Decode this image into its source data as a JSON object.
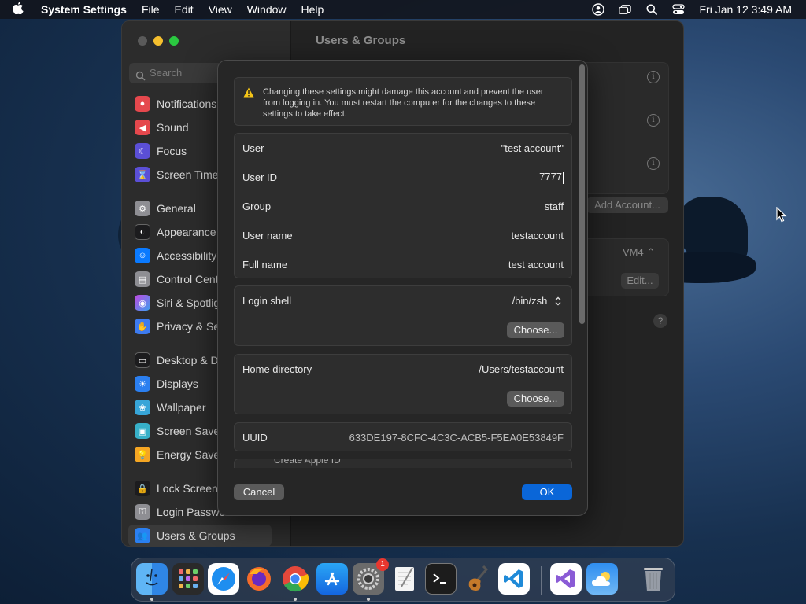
{
  "menubar": {
    "app_name": "System Settings",
    "menus": [
      "File",
      "Edit",
      "View",
      "Window",
      "Help"
    ],
    "clock": "Fri Jan 12  3:49 AM"
  },
  "sidebar": {
    "search_placeholder": "Search",
    "items": [
      {
        "label": "Notifications",
        "icon": "bell-icon",
        "color": "#e5484d"
      },
      {
        "label": "Sound",
        "icon": "speaker-icon",
        "color": "#e5484d"
      },
      {
        "label": "Focus",
        "icon": "moon-icon",
        "color": "#5b4fd6"
      },
      {
        "label": "Screen Time",
        "icon": "hourglass-icon",
        "color": "#5b4fd6"
      },
      {
        "label": "General",
        "icon": "gear-icon",
        "color": "#8e8e93"
      },
      {
        "label": "Appearance",
        "icon": "appearance-icon",
        "color": "#1c1c1e"
      },
      {
        "label": "Accessibility",
        "icon": "accessibility-icon",
        "color": "#0a7aff"
      },
      {
        "label": "Control Cente",
        "icon": "control-center-icon",
        "color": "#8e8e93"
      },
      {
        "label": "Siri & Spotlig",
        "icon": "siri-icon",
        "color": "#c148e0"
      },
      {
        "label": "Privacy & Sec",
        "icon": "hand-icon",
        "color": "#3d7bf0"
      },
      {
        "label": "Desktop & Do",
        "icon": "dock-icon",
        "color": "#1c1c1e"
      },
      {
        "label": "Displays",
        "icon": "sun-icon",
        "color": "#2b7ff0"
      },
      {
        "label": "Wallpaper",
        "icon": "wallpaper-icon",
        "color": "#37a5d8"
      },
      {
        "label": "Screen Saver",
        "icon": "screensaver-icon",
        "color": "#37b0c8"
      },
      {
        "label": "Energy Saver",
        "icon": "bulb-icon",
        "color": "#f5a623"
      },
      {
        "label": "Lock Screen",
        "icon": "lock-icon",
        "color": "#1c1c1e"
      },
      {
        "label": "Login Passwo",
        "icon": "key-icon",
        "color": "#8e8e93"
      },
      {
        "label": "Users & Groups",
        "icon": "users-icon",
        "color": "#2b7ff0"
      }
    ]
  },
  "content": {
    "title": "Users & Groups",
    "add_account": "Add Account...",
    "vm_select": "VM4",
    "edit": "Edit...",
    "help": "?"
  },
  "dialog": {
    "warning": "Changing these settings might damage this account and prevent the user from logging in. You must restart the computer for the changes to these settings to take effect.",
    "fields": [
      {
        "label": "User",
        "value": "\"test account\""
      },
      {
        "label": "User ID",
        "value": "7777"
      },
      {
        "label": "Group",
        "value": "staff"
      },
      {
        "label": "User name",
        "value": "testaccount"
      },
      {
        "label": "Full name",
        "value": "test account"
      }
    ],
    "login_shell": {
      "label": "Login shell",
      "value": "/bin/zsh",
      "choose": "Choose..."
    },
    "home_directory": {
      "label": "Home directory",
      "value": "/Users/testaccount",
      "choose": "Choose..."
    },
    "uuid": {
      "label": "UUID",
      "value": "633DE197-8CFC-4C3C-ACB5-F5EA0E53849F"
    },
    "cut_item": "Create Apple ID",
    "cancel": "Cancel",
    "ok": "OK"
  },
  "dock": {
    "settings_badge": "1",
    "apps": [
      "finder-icon",
      "launchpad-icon",
      "safari-icon",
      "firefox-icon",
      "chrome-icon",
      "app-store-icon",
      "system-settings-icon",
      "textedit-icon",
      "terminal-icon",
      "instruments-icon",
      "vscode-icon",
      "visual-studio-icon",
      "weather-icon",
      "trash-icon"
    ]
  },
  "colors": {
    "accent": "#0a66d8",
    "dialog_bg": "#262626",
    "warning": "#f5c518"
  }
}
